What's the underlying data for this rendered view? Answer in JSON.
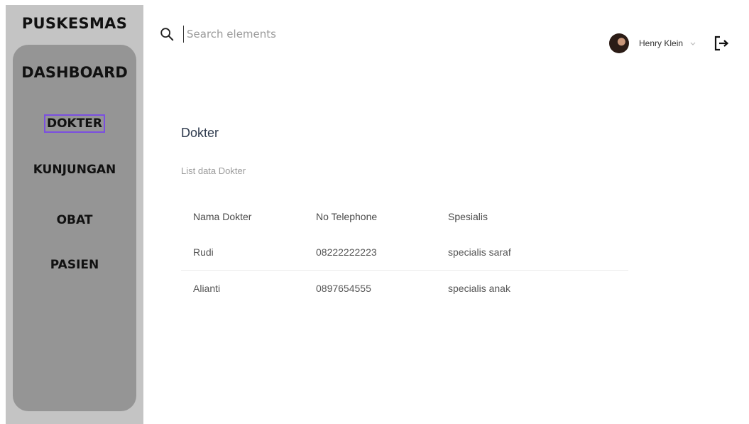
{
  "sidebar": {
    "brand": "PUSKESMAS",
    "dashboard_label": "DASHBOARD",
    "items": [
      {
        "label": "DOKTER",
        "active": true
      },
      {
        "label": "KUNJUNGAN",
        "active": false
      },
      {
        "label": "OBAT",
        "active": false
      },
      {
        "label": "PASIEN",
        "active": false
      }
    ]
  },
  "header": {
    "search": {
      "placeholder": "Search elements",
      "value": ""
    },
    "user": {
      "name": "Henry Klein"
    }
  },
  "main": {
    "title": "Dokter",
    "subtitle": "List data Dokter",
    "table": {
      "columns": [
        "Nama Dokter",
        "No Telephone",
        "Spesialis"
      ],
      "rows": [
        [
          "Rudi",
          "08222222223",
          "specialis saraf"
        ],
        [
          "Alianti",
          "0897654555",
          "specialis anak"
        ]
      ]
    }
  },
  "colors": {
    "sidebar_bg": "#c4c4c4",
    "nav_panel_bg": "#959595",
    "active_outline": "#7b4fe0"
  },
  "icons": [
    "search-icon",
    "avatar",
    "chevron-down-icon",
    "logout-icon"
  ]
}
